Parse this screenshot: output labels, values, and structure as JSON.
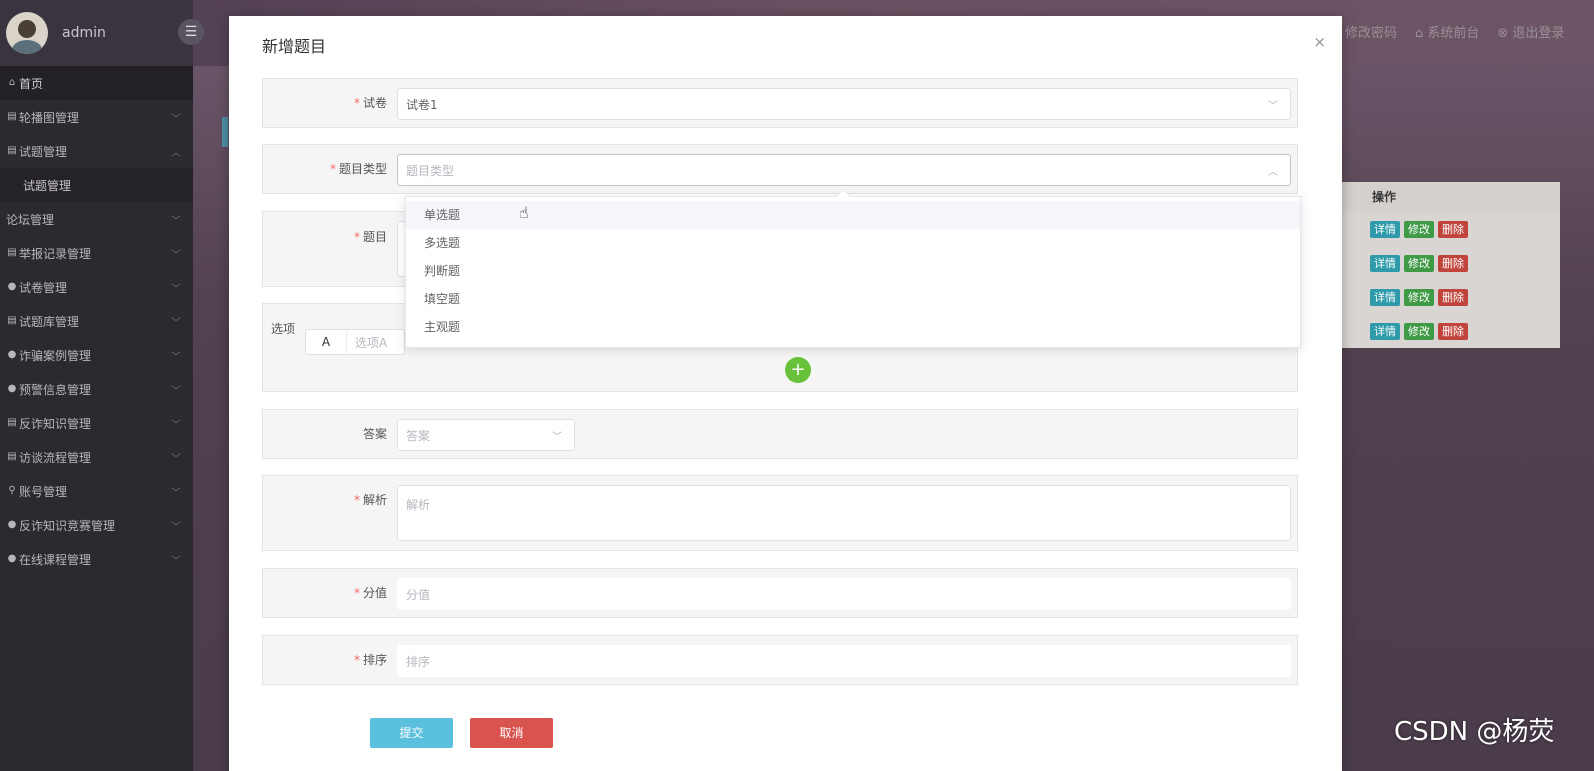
{
  "sidebar": {
    "user": "admin",
    "menu_toggle_icon": "menu-icon",
    "items": [
      {
        "label": "首页",
        "icon": "⌂",
        "state": "active"
      },
      {
        "label": "轮播图管理",
        "icon": "▤"
      },
      {
        "label": "试题管理",
        "icon": "▤",
        "expanded": true
      },
      {
        "label": "试题管理",
        "icon": "",
        "state": "sub"
      },
      {
        "label": "论坛管理",
        "icon": ""
      },
      {
        "label": "举报记录管理",
        "icon": "▤"
      },
      {
        "label": "试卷管理",
        "icon": "●"
      },
      {
        "label": "试题库管理",
        "icon": "▤"
      },
      {
        "label": "诈骗案例管理",
        "icon": "●"
      },
      {
        "label": "预警信息管理",
        "icon": "●"
      },
      {
        "label": "反诈知识管理",
        "icon": "▤"
      },
      {
        "label": "访谈流程管理",
        "icon": "▤"
      },
      {
        "label": "账号管理",
        "icon": "⚲"
      },
      {
        "label": "反诈知识竞赛管理",
        "icon": "●"
      },
      {
        "label": "在线课程管理",
        "icon": "●"
      }
    ]
  },
  "topbar": {
    "change_password": "修改密码",
    "system_front": "⌂ 系统前台",
    "logout": "⊗ 退出登录"
  },
  "bg_table": {
    "header": "操作",
    "row_buttons": {
      "detail": "详情",
      "edit": "修改",
      "delete": "删除"
    }
  },
  "modal": {
    "title": "新增题目",
    "close": "×",
    "fields": {
      "paper": {
        "label": "试卷",
        "value": "试卷1"
      },
      "type": {
        "label": "题目类型",
        "placeholder": "题目类型"
      },
      "question": {
        "label": "题目"
      },
      "options": {
        "label": "选项",
        "key": "A",
        "placeholder": "选项A",
        "add": "+"
      },
      "answer": {
        "label": "答案",
        "placeholder": "答案"
      },
      "analysis": {
        "label": "解析",
        "placeholder": "解析"
      },
      "score": {
        "label": "分值",
        "placeholder": "分值"
      },
      "order": {
        "label": "排序",
        "placeholder": "排序"
      }
    },
    "type_options": [
      "单选题",
      "多选题",
      "判断题",
      "填空题",
      "主观题"
    ],
    "submit": "提交",
    "cancel": "取消"
  },
  "watermark": "CSDN @杨荧"
}
